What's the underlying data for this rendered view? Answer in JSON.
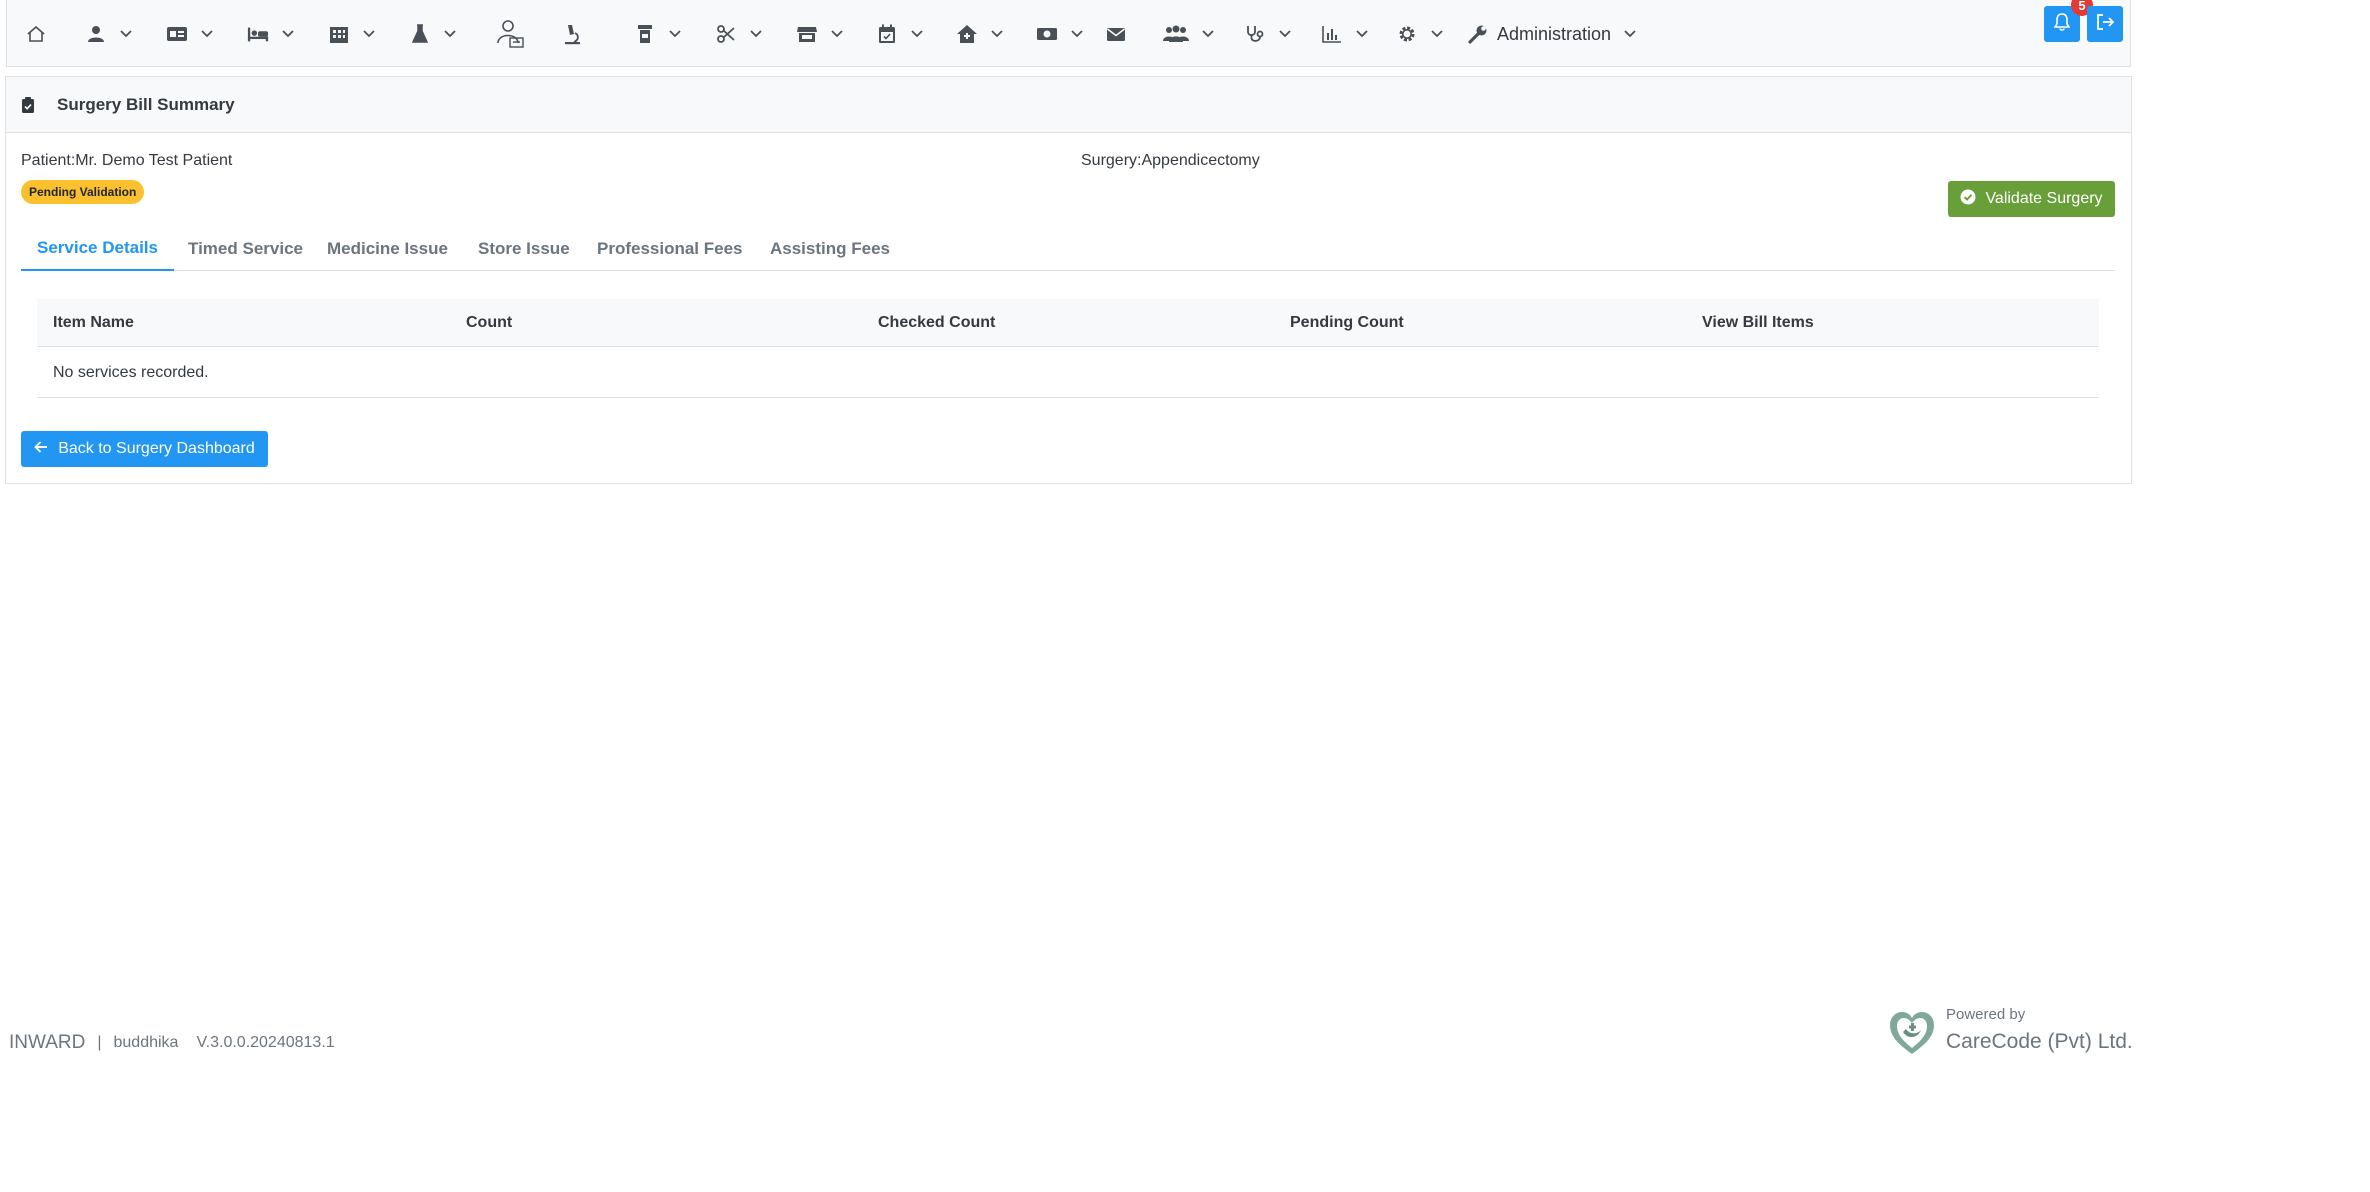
{
  "nav": {
    "items": [
      {
        "name": "home",
        "icon": "home-icon",
        "has_menu": false
      },
      {
        "name": "opd",
        "icon": "user-icon",
        "has_menu": true
      },
      {
        "name": "channelling",
        "icon": "id-card-icon",
        "has_menu": true
      },
      {
        "name": "inward",
        "icon": "bed-icon",
        "has_menu": true
      },
      {
        "name": "hospital",
        "icon": "building-icon",
        "has_menu": true
      },
      {
        "name": "lab",
        "icon": "flask-icon",
        "has_menu": true
      },
      {
        "name": "doctor",
        "icon": "doctor-icon",
        "has_menu": false
      },
      {
        "name": "microscope",
        "icon": "microscope-icon",
        "has_menu": false
      },
      {
        "name": "pharmacy",
        "icon": "prescription-bottle-icon",
        "has_menu": true
      },
      {
        "name": "theatre",
        "icon": "scissors-icon",
        "has_menu": true
      },
      {
        "name": "store",
        "icon": "store-icon",
        "has_menu": true
      },
      {
        "name": "appointments",
        "icon": "calendar-icon",
        "has_menu": true
      },
      {
        "name": "house",
        "icon": "house-medical-icon",
        "has_menu": true
      },
      {
        "name": "cashier",
        "icon": "money-bill-icon",
        "has_menu": true
      },
      {
        "name": "messages",
        "icon": "envelope-icon",
        "has_menu": false
      },
      {
        "name": "hr",
        "icon": "users-icon",
        "has_menu": true
      },
      {
        "name": "clinical",
        "icon": "stethoscope-icon",
        "has_menu": true
      },
      {
        "name": "reports",
        "icon": "chart-bar-icon",
        "has_menu": true
      },
      {
        "name": "settings",
        "icon": "gear-icon",
        "has_menu": true
      }
    ],
    "admin_label": "Administration",
    "notification_count": "5"
  },
  "card": {
    "title": "Surgery Bill Summary",
    "patient": "Patient:Mr. Demo Test Patient",
    "surgery": "Surgery:Appendicectomy",
    "status": "Pending Validation",
    "validate_label": "Validate Surgery",
    "tabs": [
      "Service Details",
      "Timed Service",
      "Medicine Issue",
      "Store Issue",
      "Professional Fees",
      "Assisting Fees"
    ],
    "active_tab": "Service Details",
    "table": {
      "headers": [
        "Item Name",
        "Count",
        "Checked Count",
        "Pending Count",
        "View Bill Items"
      ],
      "empty_message": "No services recorded."
    },
    "back_label": "Back to Surgery Dashboard"
  },
  "footer": {
    "module": "INWARD",
    "separator": "|",
    "user": "buddhika",
    "version": "V.3.0.0.20240813.1",
    "powered_by": "Powered by",
    "company": "CareCode (Pvt) Ltd."
  },
  "colors": {
    "primary": "#2196f3",
    "success": "#689f38",
    "warning": "#fbc02d",
    "danger": "#e53935"
  }
}
